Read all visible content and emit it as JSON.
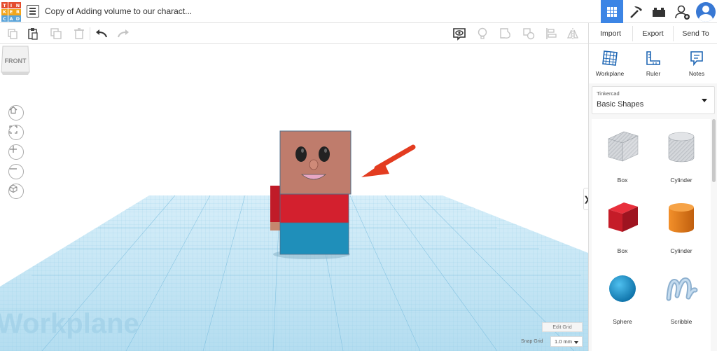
{
  "app": {
    "logo_letters": [
      "T",
      "I",
      "N",
      "K",
      "E",
      "R",
      "C",
      "A",
      "D"
    ],
    "logo_colors": [
      "#e44c2e",
      "#e44c2e",
      "#e44c2e",
      "#f2a51a",
      "#f2a51a",
      "#f2a51a",
      "#5ba4d9",
      "#5ba4d9",
      "#5ba4d9"
    ],
    "project_title": "Copy of Adding volume to our charact...",
    "accent_color": "#3c85e5"
  },
  "header_icons": [
    "3d-view-grid-icon",
    "codeblocks-pickaxe-icon",
    "bricks-icon",
    "invite-user-icon",
    "user-avatar-icon"
  ],
  "toolbar": {
    "icons": [
      "copy-icon",
      "paste-icon",
      "duplicate-icon",
      "delete-icon",
      "undo-icon",
      "redo-icon",
      "show-all-icon",
      "light-bulb-icon",
      "group-icon",
      "ungroup-icon",
      "align-icon",
      "mirror-icon"
    ]
  },
  "panel": {
    "import_label": "Import",
    "export_label": "Export",
    "send_to_label": "Send To",
    "tools": [
      {
        "label": "Workplane",
        "icon": "workplane-icon"
      },
      {
        "label": "Ruler",
        "icon": "ruler-icon"
      },
      {
        "label": "Notes",
        "icon": "notes-icon"
      }
    ],
    "library_source": "Tinkercad",
    "library_name": "Basic Shapes",
    "shapes": [
      {
        "label": "Box",
        "icon": "hole-box-icon",
        "color": "#c9ccd0"
      },
      {
        "label": "Cylinder",
        "icon": "hole-cylinder-icon",
        "color": "#c9ccd0"
      },
      {
        "label": "Box",
        "icon": "box-icon",
        "color": "#d3202e"
      },
      {
        "label": "Cylinder",
        "icon": "cylinder-icon",
        "color": "#e57a1a"
      },
      {
        "label": "Sphere",
        "icon": "sphere-icon",
        "color": "#1f8fcb"
      },
      {
        "label": "Scribble",
        "icon": "scribble-icon",
        "color": "#9ab7d2"
      }
    ]
  },
  "viewport": {
    "viewcube_label": "FRONT",
    "workplane_watermark": "Workplane",
    "edit_grid_label": "Edit Grid",
    "snap_grid_label": "Snap Grid",
    "snap_grid_value": "1.0 mm",
    "nav_icons": [
      "home-view-icon",
      "fit-all-icon",
      "zoom-in-icon",
      "zoom-out-icon",
      "perspective-icon"
    ]
  },
  "model_colors": {
    "head": "#bf7c6c",
    "shirt": "#d3202e",
    "pants": "#1f8fba",
    "arrow": "#e33c20",
    "grid": "#c6e6f5"
  }
}
